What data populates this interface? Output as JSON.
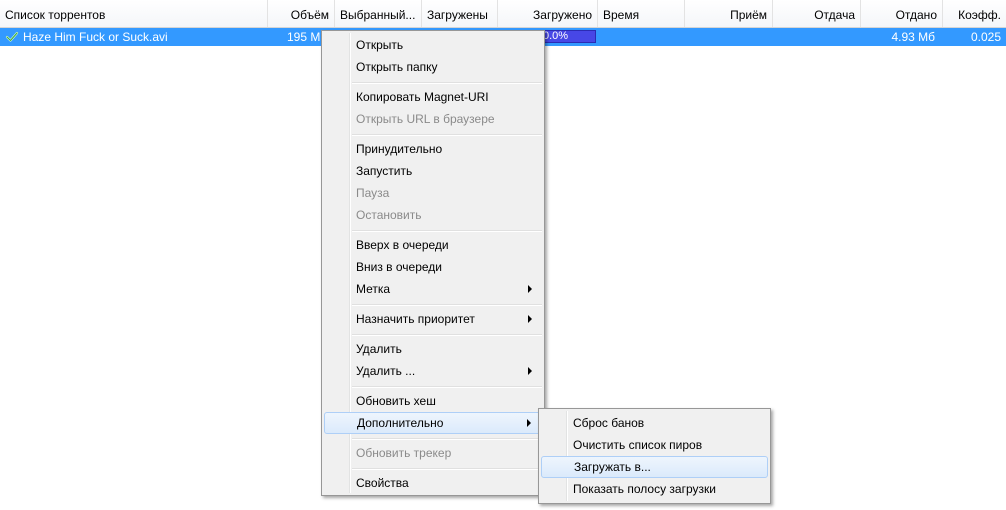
{
  "columns": [
    {
      "label": "Список торрентов"
    },
    {
      "label": "Объём"
    },
    {
      "label": "Выбранный..."
    },
    {
      "label": "Загружены"
    },
    {
      "label": "Загружено"
    },
    {
      "label": "Время"
    },
    {
      "label": "Приём"
    },
    {
      "label": "Отдача"
    },
    {
      "label": "Отдано"
    },
    {
      "label": "Коэфф."
    }
  ],
  "torrent": {
    "name": "Haze Him Fuck or Suck.avi",
    "size": "195 M",
    "progress_text": "0.0%",
    "progress_value": 0.0,
    "uploaded": "4.93 Мб",
    "ratio": "0.025",
    "status_icon": "checkmark-icon"
  },
  "context_menu": {
    "items": [
      {
        "label": "Открыть"
      },
      {
        "label": "Открыть папку"
      },
      {
        "label": "Копировать Magnet-URI"
      },
      {
        "label": "Открыть URL в браузере"
      },
      {
        "label": "Принудительно"
      },
      {
        "label": "Запустить"
      },
      {
        "label": "Пауза"
      },
      {
        "label": "Остановить"
      },
      {
        "label": "Вверх в очереди"
      },
      {
        "label": "Вниз в очереди"
      },
      {
        "label": "Метка"
      },
      {
        "label": "Назначить приоритет"
      },
      {
        "label": "Удалить"
      },
      {
        "label": "Удалить ..."
      },
      {
        "label": "Обновить хеш"
      },
      {
        "label": "Дополнительно"
      },
      {
        "label": "Обновить трекер"
      },
      {
        "label": "Свойства"
      }
    ]
  },
  "submenu": {
    "items": [
      {
        "label": "Сброс банов"
      },
      {
        "label": "Очистить список пиров"
      },
      {
        "label": "Загружать в..."
      },
      {
        "label": "Показать полосу загрузки"
      }
    ]
  },
  "colors": {
    "selection": "#3399ff",
    "progress": "#4747e6",
    "menu_bg": "#f0f0f0",
    "disabled_text": "#8a8a8a"
  }
}
